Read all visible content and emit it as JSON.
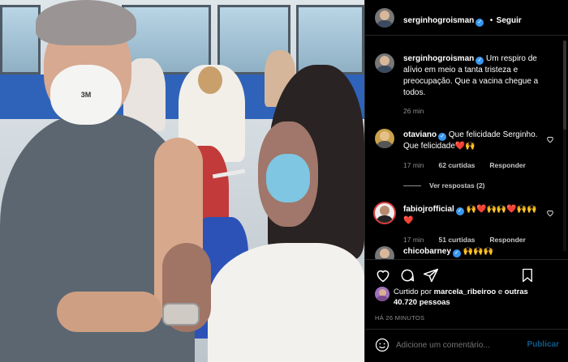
{
  "post": {
    "author": "serginhogroisman",
    "follow_separator": "•",
    "follow_label": "Seguir",
    "caption": "Um respiro de alívio em meio a tanta tristeza e preocupação. Que a vacina chegue a todos.",
    "caption_time": "26 min",
    "mask_brand": "3M"
  },
  "comments": [
    {
      "user": "otaviano",
      "verified": true,
      "text": "Que felicidade Serginho. Que felicidade❤️🙌",
      "time": "17 min",
      "likes": "62 curtidas",
      "reply": "Responder",
      "view_replies": "Ver respostas (2)"
    },
    {
      "user": "fabiojrofficial",
      "verified": true,
      "text": "🙌❤️🙌🙌❤️🙌🙌❤️",
      "time": "17 min",
      "likes": "51 curtidas",
      "reply": "Responder"
    },
    {
      "user": "chicobarney",
      "verified": true,
      "text": "🙌🙌🙌"
    }
  ],
  "likes": {
    "prefix": "Curtido por",
    "user": "marcela_ribeiroo",
    "conj": "e",
    "others": "outras 40.720 pessoas"
  },
  "post_time": "HÁ 26 MINUTOS",
  "comment_input": {
    "placeholder": "Adicione um comentário...",
    "publish": "Publicar"
  },
  "icons": [
    "heart-icon",
    "comment-icon",
    "share-icon",
    "bookmark-icon",
    "emoji-icon",
    "verified-icon"
  ],
  "colors": {
    "verified": "#3897f0",
    "link": "#e0f1ff",
    "publish": "#0e5a8a"
  }
}
